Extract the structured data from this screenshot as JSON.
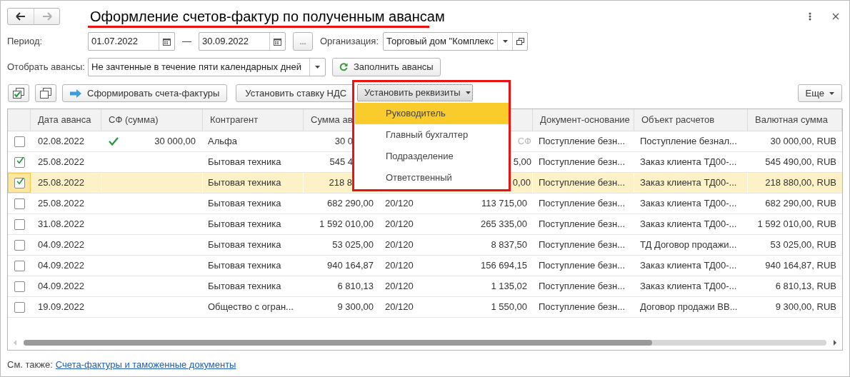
{
  "window": {
    "title": "Оформление счетов-фактур по полученным авансам",
    "nav": [
      {
        "kind": "back",
        "disabled": false
      },
      {
        "kind": "forward",
        "disabled": true
      }
    ]
  },
  "filters": {
    "period_label": "Период:",
    "date_from": "01.07.2022",
    "dash": "—",
    "date_to": "30.09.2022",
    "more_button": "...",
    "org_label": "Организация:",
    "org_value": "Торговый дом \"Комплекс",
    "advances_label": "Отобрать авансы:",
    "advances_value": "Не зачтенные в течение пяти календарных дней",
    "fill_button": "Заполнить авансы"
  },
  "toolbar": {
    "create_button": "Сформировать счета-фактуры",
    "vat_button": "Установить ставку НДС",
    "details_button": "Установить реквизиты",
    "more_button": "Еще"
  },
  "details_menu": [
    {
      "label": "Руководитель",
      "selected": true
    },
    {
      "label": "Главный бухгалтер",
      "selected": false
    },
    {
      "label": "Подразделение",
      "selected": false
    },
    {
      "label": "Ответственный",
      "selected": false
    }
  ],
  "table": {
    "columns": [
      "Дата аванса",
      "СФ (сумма)",
      "Контрагент",
      "Сумма ав",
      "Документ-основание",
      "Объект расчетов",
      "Валютная сумма"
    ],
    "rows": [
      {
        "checked": false,
        "selected": false,
        "under_menu": true,
        "date": "02.08.2022",
        "sf_done": true,
        "sf_sum": "30 000,00",
        "counterparty": "Альфа",
        "amount": "30 0",
        "vat": "СФ",
        "vat_muted": true,
        "basis": "Поступление безн...",
        "object": "Поступление безнал...",
        "currency_sum": "30 000,00, RUB"
      },
      {
        "checked": true,
        "selected": false,
        "under_menu": true,
        "date": "25.08.2022",
        "sf_done": false,
        "counterparty": "Бытовая техника",
        "amount": "545 4",
        "vat": "5,00",
        "vat_muted": false,
        "basis": "Поступление безн...",
        "object": "Заказ клиента ТД00-...",
        "currency_sum": "545 490,00, RUB"
      },
      {
        "checked": true,
        "selected": true,
        "under_menu": true,
        "date": "25.08.2022",
        "sf_done": false,
        "counterparty": "Бытовая техника",
        "amount": "218 8",
        "vat": "0,00",
        "vat_muted": false,
        "basis": "Поступление безн...",
        "object": "Заказ клиента ТД00-...",
        "currency_sum": "218 880,00, RUB"
      },
      {
        "checked": false,
        "selected": false,
        "under_menu": false,
        "date": "25.08.2022",
        "sf_done": false,
        "counterparty": "Бытовая техника",
        "amount": "682 290,00",
        "rate": "20/120",
        "vat": "113 715,00",
        "vat_muted": false,
        "basis": "Поступление безн...",
        "object": "Заказ клиента ТД00-...",
        "currency_sum": "682 290,00, RUB"
      },
      {
        "checked": false,
        "selected": false,
        "under_menu": false,
        "date": "31.08.2022",
        "sf_done": false,
        "counterparty": "Бытовая техника",
        "amount": "1 592 010,00",
        "rate": "20/120",
        "vat": "265 335,00",
        "vat_muted": false,
        "basis": "Поступление безн...",
        "object": "Заказ клиента ТД00-...",
        "currency_sum": "1 592 010,00, RUB"
      },
      {
        "checked": false,
        "selected": false,
        "under_menu": false,
        "date": "04.09.2022",
        "sf_done": false,
        "counterparty": "Бытовая техника",
        "amount": "53 025,00",
        "rate": "20/120",
        "vat": "8 837,50",
        "vat_muted": false,
        "basis": "Поступление безн...",
        "object": "ТД Договор продажи...",
        "currency_sum": "53 025,00, RUB"
      },
      {
        "checked": false,
        "selected": false,
        "under_menu": false,
        "date": "04.09.2022",
        "sf_done": false,
        "counterparty": "Бытовая техника",
        "amount": "940 164,87",
        "rate": "20/120",
        "vat": "156 694,15",
        "vat_muted": false,
        "basis": "Поступление безн...",
        "object": "Заказ клиента ТД00-...",
        "currency_sum": "940 164,87, RUB"
      },
      {
        "checked": false,
        "selected": false,
        "under_menu": false,
        "date": "04.09.2022",
        "sf_done": false,
        "counterparty": "Бытовая техника",
        "amount": "6 810,13",
        "rate": "20/120",
        "vat": "1 135,02",
        "vat_muted": false,
        "basis": "Поступление безн...",
        "object": "Заказ клиента ТД00-...",
        "currency_sum": "6 810,13, RUB"
      },
      {
        "checked": false,
        "selected": false,
        "under_menu": false,
        "date": "19.09.2022",
        "sf_done": false,
        "counterparty": "Общество с огран...",
        "amount": "9 300,00",
        "rate": "20/120",
        "vat": "1 550,00",
        "vat_muted": false,
        "basis": "Поступление безн...",
        "object": "Договор продажи ВВ...",
        "currency_sum": "9 300,00, RUB"
      }
    ]
  },
  "footer": {
    "label": "См. также:",
    "link": "Счета-фактуры и таможенные документы"
  }
}
